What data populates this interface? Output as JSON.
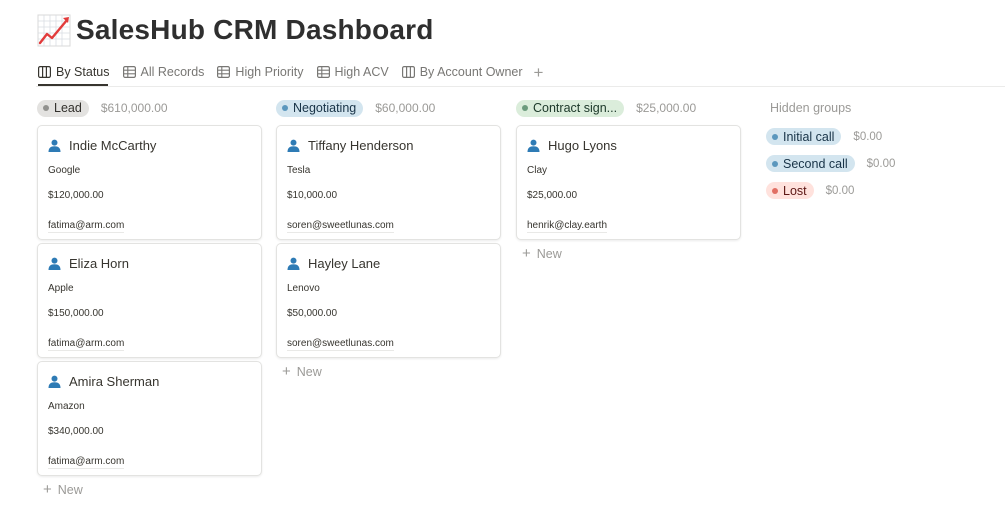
{
  "page": {
    "title": "SalesHub CRM Dashboard",
    "icon": "chart-increasing-icon"
  },
  "tabs": [
    {
      "label": "By Status",
      "icon": "board-icon",
      "active": true
    },
    {
      "label": "All Records",
      "icon": "table-icon",
      "active": false
    },
    {
      "label": "High Priority",
      "icon": "table-icon",
      "active": false
    },
    {
      "label": "High ACV",
      "icon": "table-icon",
      "active": false
    },
    {
      "label": "By Account Owner",
      "icon": "board-icon",
      "active": false
    }
  ],
  "add_tab_label": "+",
  "new_label": "New",
  "columns": [
    {
      "status": "Lead",
      "color": "#91918e",
      "total": "$610,000.00",
      "cards": [
        {
          "name": "Indie McCarthy",
          "company": "Google",
          "value": "$120,000.00",
          "email": "fatima@arm.com"
        },
        {
          "name": "Eliza Horn",
          "company": "Apple",
          "value": "$150,000.00",
          "email": "fatima@arm.com"
        },
        {
          "name": "Amira Sherman",
          "company": "Amazon",
          "value": "$340,000.00",
          "email": "fatima@arm.com"
        }
      ]
    },
    {
      "status": "Negotiating",
      "color": "#5b97bd",
      "total": "$60,000.00",
      "cards": [
        {
          "name": "Tiffany Henderson",
          "company": "Tesla",
          "value": "$10,000.00",
          "email": "soren@sweetlunas.com"
        },
        {
          "name": "Hayley Lane",
          "company": "Lenovo",
          "value": "$50,000.00",
          "email": "soren@sweetlunas.com"
        }
      ]
    },
    {
      "status": "Contract sign...",
      "color": "#6c9b7d",
      "total": "$25,000.00",
      "cards": [
        {
          "name": "Hugo Lyons",
          "company": "Clay",
          "value": "$25,000.00",
          "email": "henrik@clay.earth"
        }
      ]
    }
  ],
  "hidden_groups": {
    "title": "Hidden groups",
    "groups": [
      {
        "status": "Initial call",
        "color": "#5b97bd",
        "total": "$0.00"
      },
      {
        "status": "Second call",
        "color": "#5b97bd",
        "total": "$0.00"
      },
      {
        "status": "Lost",
        "color": "#e16f64",
        "total": "$0.00"
      }
    ]
  },
  "person_icon": "person-icon",
  "accent_color": "#2e7bb5"
}
